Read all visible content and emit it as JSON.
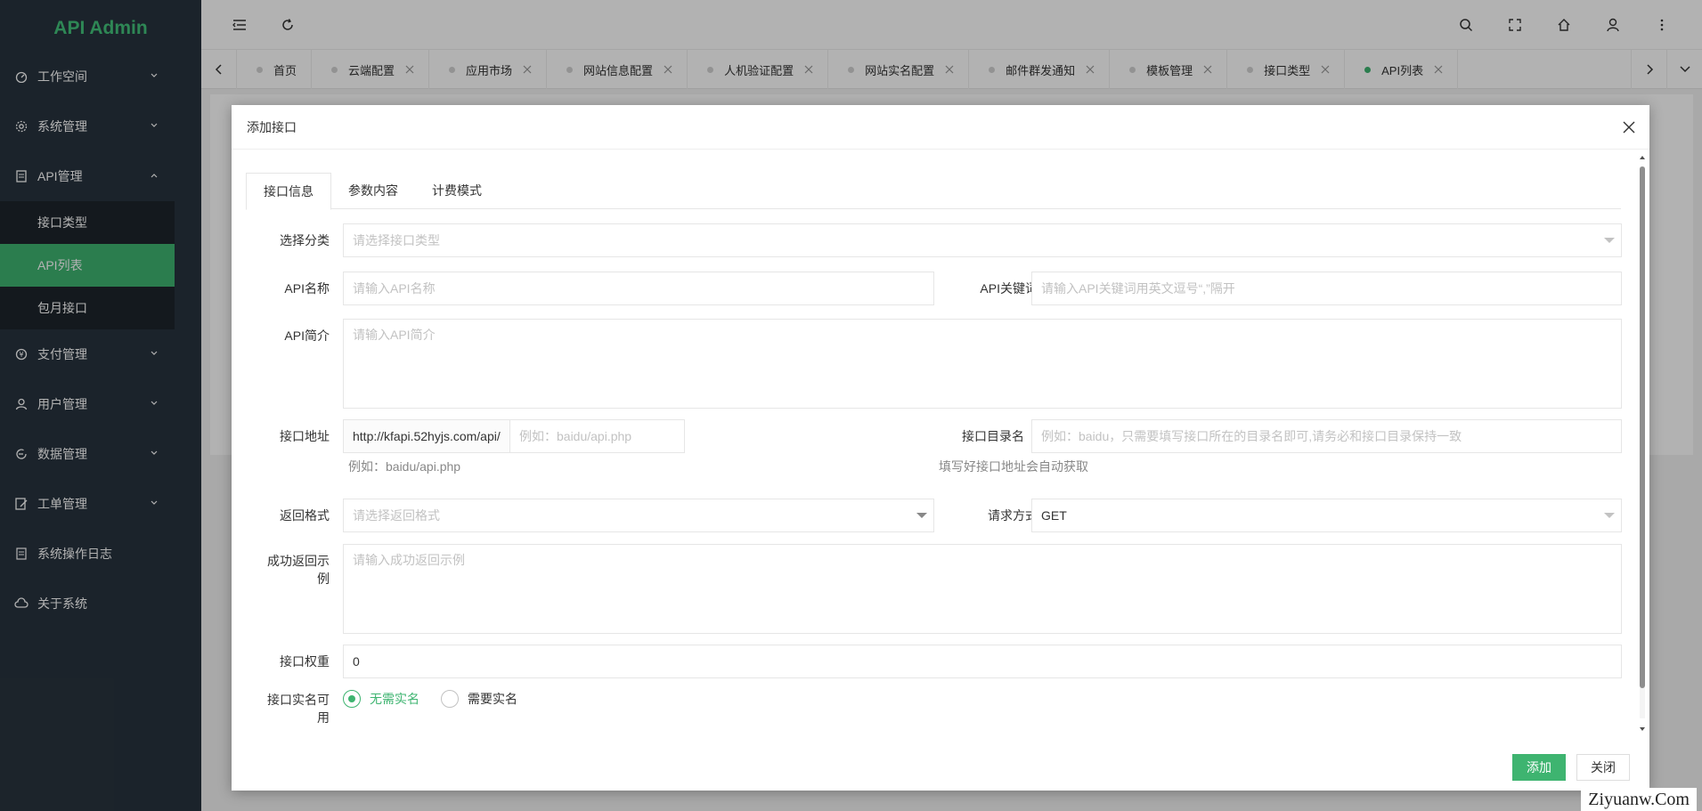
{
  "app": {
    "title": "API Admin"
  },
  "sidebar": {
    "items": [
      {
        "label": "工作空间",
        "icon": "dashboard-icon"
      },
      {
        "label": "系统管理",
        "icon": "gear-icon"
      },
      {
        "label": "API管理",
        "icon": "document-icon",
        "expanded": true,
        "children": [
          {
            "label": "接口类型"
          },
          {
            "label": "API列表",
            "active": true
          },
          {
            "label": "包月接口"
          }
        ]
      },
      {
        "label": "支付管理",
        "icon": "yen-icon"
      },
      {
        "label": "用户管理",
        "icon": "user-icon"
      },
      {
        "label": "数据管理",
        "icon": "data-icon"
      },
      {
        "label": "工单管理",
        "icon": "ticket-icon"
      },
      {
        "label": "系统操作日志",
        "icon": "log-icon"
      },
      {
        "label": "关于系统",
        "icon": "cloud-icon"
      }
    ]
  },
  "tabs": [
    {
      "label": "首页",
      "closable": false
    },
    {
      "label": "云端配置",
      "closable": true
    },
    {
      "label": "应用市场",
      "closable": true
    },
    {
      "label": "网站信息配置",
      "closable": true
    },
    {
      "label": "人机验证配置",
      "closable": true
    },
    {
      "label": "网站实名配置",
      "closable": true
    },
    {
      "label": "邮件群发通知",
      "closable": true
    },
    {
      "label": "模板管理",
      "closable": true
    },
    {
      "label": "接口类型",
      "closable": true
    },
    {
      "label": "API列表",
      "closable": true,
      "active": true
    }
  ],
  "modal": {
    "title": "添加接口",
    "tabs": [
      "接口信息",
      "参数内容",
      "计费模式"
    ],
    "form": {
      "category": {
        "label": "选择分类",
        "placeholder": "请选择接口类型"
      },
      "api_name": {
        "label": "API名称",
        "placeholder": "请输入API名称"
      },
      "api_keywords": {
        "label": "API关键词",
        "placeholder": "请输入API关键词用英文逗号“,”隔开"
      },
      "api_intro": {
        "label": "API简介",
        "placeholder": "请输入API简介"
      },
      "endpoint": {
        "label": "接口地址",
        "prefix": "http://kfapi.52hyjs.com/api/",
        "placeholder": "例如：baidu/api.php",
        "hint": "例如：baidu/api.php"
      },
      "directory": {
        "label": "接口目录名",
        "placeholder": "例如：baidu，只需要填写接口所在的目录名即可,请务必和接口目录保持一致",
        "hint": "填写好接口地址会自动获取"
      },
      "return_format": {
        "label": "返回格式",
        "placeholder": "请选择返回格式"
      },
      "request_method": {
        "label": "请求方式",
        "value": "GET"
      },
      "success_example": {
        "label": "成功返回示例",
        "placeholder": "请输入成功返回示例"
      },
      "weight": {
        "label": "接口权重",
        "value": "0"
      },
      "realname": {
        "label": "接口实名可用",
        "options": [
          "无需实名",
          "需要实名"
        ],
        "selected": 0
      }
    },
    "buttons": {
      "submit": "添加",
      "close": "关闭"
    }
  },
  "watermark": "Ziyuanw.Com",
  "colors": {
    "accent": "#3eb470",
    "sidebar": "#28333e",
    "submenu": "#1d252c"
  }
}
